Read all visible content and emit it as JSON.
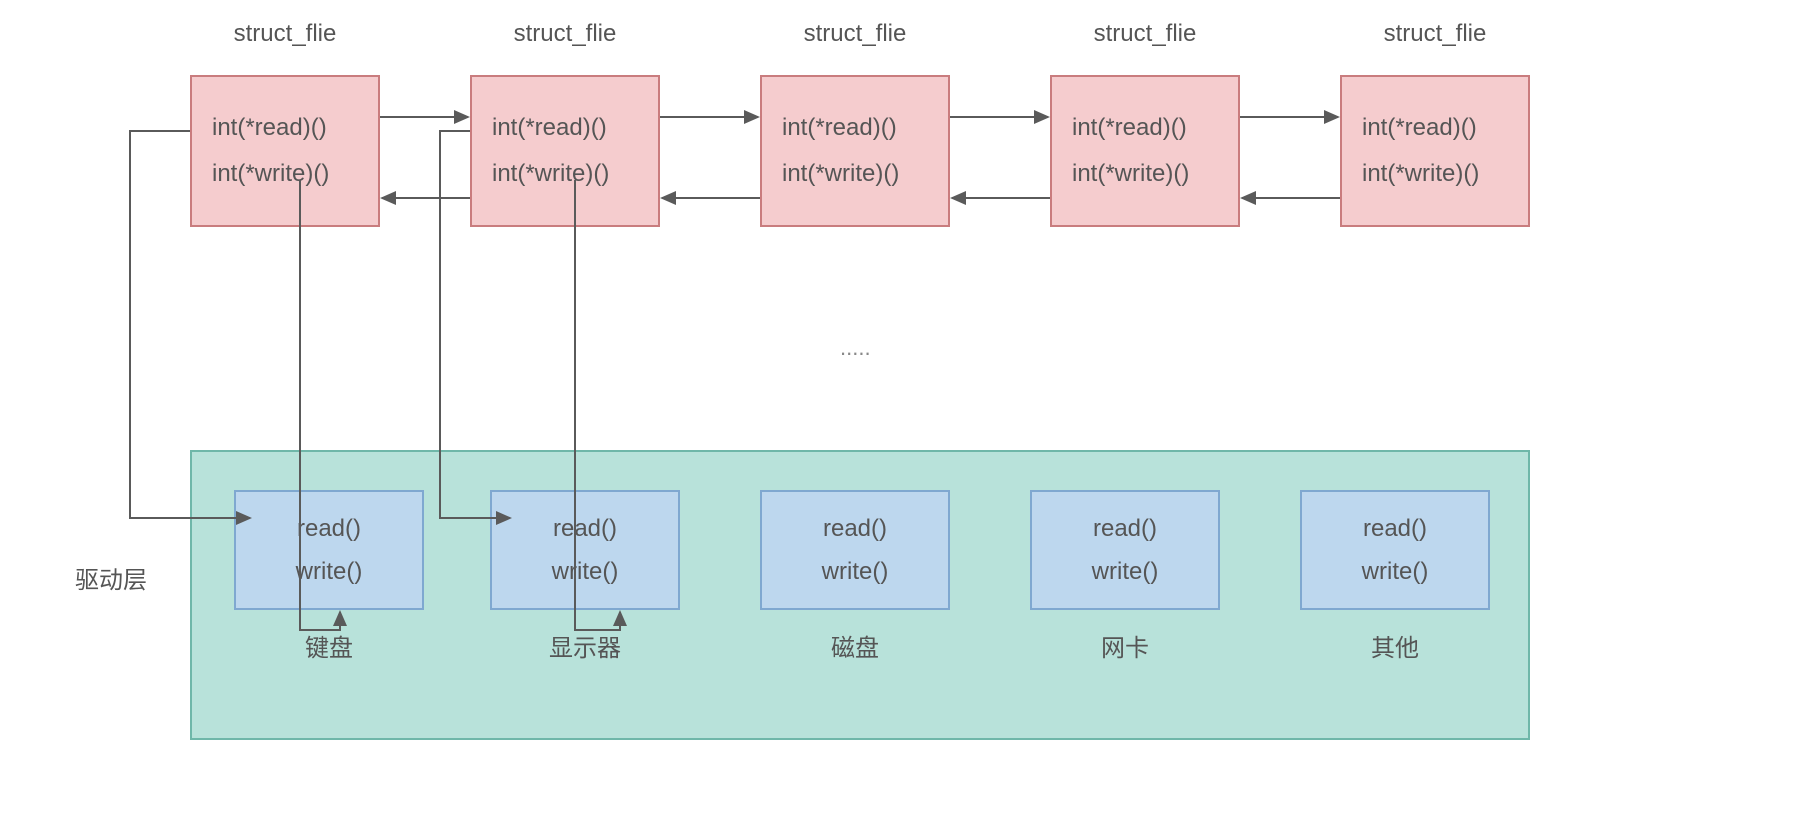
{
  "structs": [
    {
      "label": "struct_flie",
      "line1": "int(*read)()",
      "line2": "int(*write)()"
    },
    {
      "label": "struct_flie",
      "line1": "int(*read)()",
      "line2": "int(*write)()"
    },
    {
      "label": "struct_flie",
      "line1": "int(*read)()",
      "line2": "int(*write)()"
    },
    {
      "label": "struct_flie",
      "line1": "int(*read)()",
      "line2": "int(*write)()"
    },
    {
      "label": "struct_flie",
      "line1": "int(*read)()",
      "line2": "int(*write)()"
    }
  ],
  "ellipsis": ".....",
  "driver_layer_label": "驱动层",
  "devices": [
    {
      "name": "键盘",
      "fn1": "read()",
      "fn2": "write()"
    },
    {
      "name": "显示器",
      "fn1": "read()",
      "fn2": "write()"
    },
    {
      "name": "磁盘",
      "fn1": "read()",
      "fn2": "write()"
    },
    {
      "name": "网卡",
      "fn1": "read()",
      "fn2": "write()"
    },
    {
      "name": "其他",
      "fn1": "read()",
      "fn2": "write()"
    }
  ]
}
